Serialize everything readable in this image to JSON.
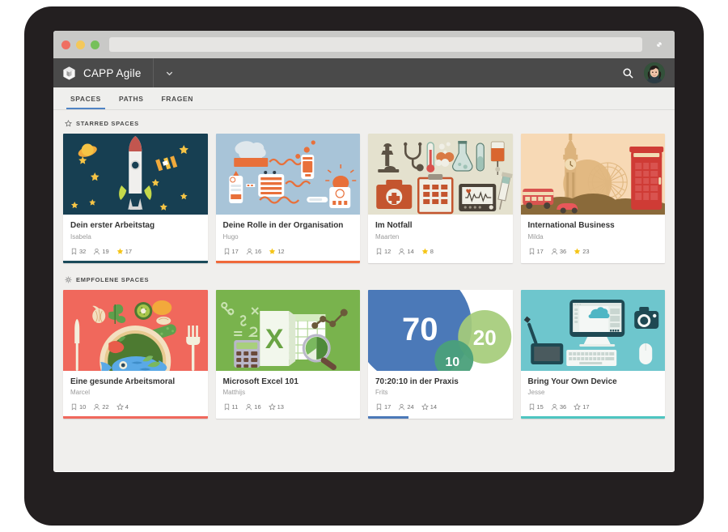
{
  "browser": {
    "url_value": "",
    "url_placeholder": "",
    "traffic_lights": [
      "close",
      "minimize",
      "zoom"
    ],
    "expand_icon": "expand-arrow-icon"
  },
  "header": {
    "brand_icon": "cube-logo-icon",
    "brand_name": "CAPP Agile",
    "caret_icon": "chevron-down-icon",
    "search_icon": "search-icon",
    "avatar_icon": "user-avatar"
  },
  "tabs": [
    {
      "label": "SPACES",
      "active": true
    },
    {
      "label": "PATHS",
      "active": false
    },
    {
      "label": "FRAGEN",
      "active": false
    }
  ],
  "sections": [
    {
      "icon": "star-outline-icon",
      "title": "STARRED SPACES",
      "cards": [
        {
          "title": "Dein erster Arbeitstag",
          "author": "Isabela",
          "thumb": "rocket-space-illustration",
          "bookmarks": "32",
          "members": "19",
          "stars": "17",
          "starred": true,
          "progress_color": "#1b4a5a",
          "progress_pct": 100
        },
        {
          "title": "Deine Rolle in der Organisation",
          "author": "Hugo",
          "thumb": "brain-network-illustration",
          "bookmarks": "17",
          "members": "16",
          "stars": "12",
          "starred": true,
          "progress_color": "#f0693a",
          "progress_pct": 100
        },
        {
          "title": "Im Notfall",
          "author": "Maarten",
          "thumb": "medical-equipment-illustration",
          "bookmarks": "12",
          "members": "14",
          "stars": "8",
          "starred": true,
          "progress_color": "#ffffff",
          "progress_pct": 0
        },
        {
          "title": "International Business",
          "author": "Milda",
          "thumb": "london-skyline-illustration",
          "bookmarks": "17",
          "members": "36",
          "stars": "23",
          "starred": true,
          "progress_color": "#ffffff",
          "progress_pct": 0
        }
      ]
    },
    {
      "icon": "sparkle-icon",
      "title": "EMPFOLENE SPACES",
      "cards": [
        {
          "title": "Eine gesunde Arbeitsmoral",
          "author": "Marcel",
          "thumb": "healthy-food-plate-illustration",
          "bookmarks": "10",
          "members": "22",
          "stars": "4",
          "starred": false,
          "progress_color": "#f0685c",
          "progress_pct": 100
        },
        {
          "title": "Microsoft Excel 101",
          "author": "Matthijs",
          "thumb": "excel-spreadsheet-illustration",
          "bookmarks": "11",
          "members": "16",
          "stars": "13",
          "starred": false,
          "progress_color": "#ffffff",
          "progress_pct": 0
        },
        {
          "title": "70:20:10 in der Praxis",
          "author": "Frits",
          "thumb": "seventy-twenty-ten-venn-illustration",
          "bookmarks": "17",
          "members": "24",
          "stars": "14",
          "starred": false,
          "progress_color": "#4b79b8",
          "progress_pct": 28
        },
        {
          "title": "Bring Your Own Device",
          "author": "Jesse",
          "thumb": "byod-workspace-illustration",
          "bookmarks": "15",
          "members": "36",
          "stars": "17",
          "starred": false,
          "progress_color": "#4ec5c1",
          "progress_pct": 100
        }
      ]
    }
  ],
  "thumb_art": {
    "rocket-space-illustration": {
      "bg": "#173f52"
    },
    "brain-network-illustration": {
      "bg": "#a8c4d8"
    },
    "medical-equipment-illustration": {
      "bg": "#e4e1ce"
    },
    "london-skyline-illustration": {
      "bg": "#f7d9b5"
    },
    "healthy-food-plate-illustration": {
      "bg": "#f0685c"
    },
    "excel-spreadsheet-illustration": {
      "bg": "#79b košice"
    },
    "seventy-twenty-ten-venn-illustration": {
      "bg": "#ffffff"
    },
    "byod-workspace-illustration": {
      "bg": "#6ec6cd"
    }
  }
}
